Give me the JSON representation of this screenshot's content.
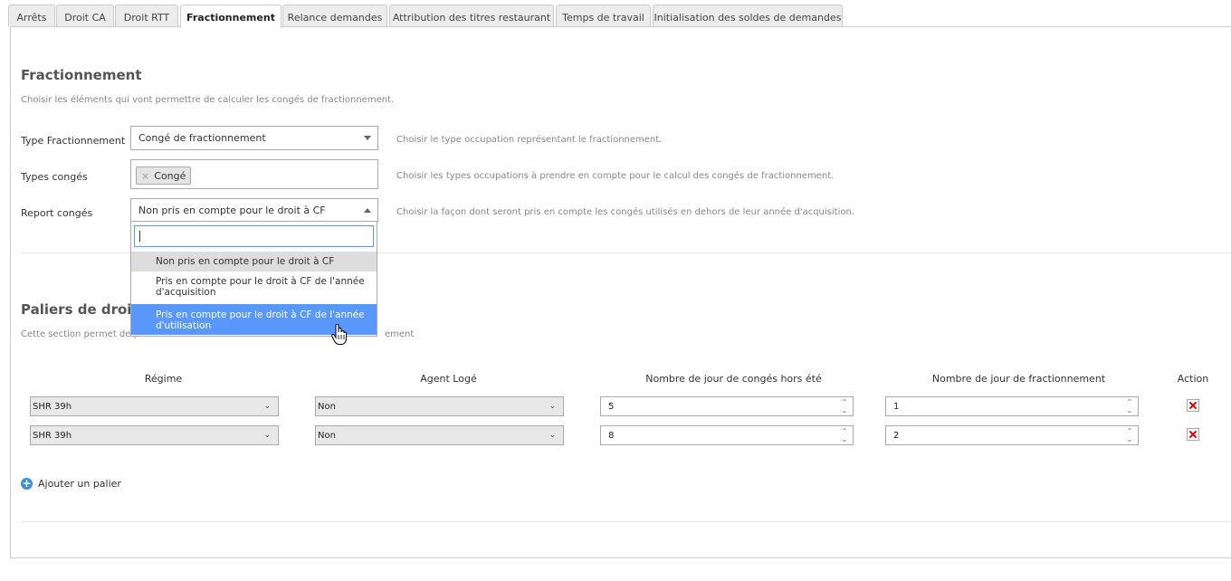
{
  "tabs": [
    "Arrêts",
    "Droit CA",
    "Droit RTT",
    "Fractionnement",
    "Relance demandes",
    "Attribution des titres restaurant",
    "Temps de travail",
    "Initialisation des soldes de demandes"
  ],
  "active_tab": "Fractionnement",
  "fractionnement": {
    "title": "Fractionnement",
    "description": "Choisir les éléments qui vont permettre de calculer les congés de fractionnement.",
    "type_label": "Type Fractionnement",
    "type_value": "Congé de fractionnement",
    "type_help": "Choisir le type occupation représentant le fractionnement.",
    "types_label": "Types congés",
    "types_chip": "Congé",
    "types_help": "Choisir les types occupations à prendre en compte pour le calcul des congés de fractionnement.",
    "report_label": "Report congés",
    "report_value": "Non pris en compte pour le droit à CF",
    "report_help": "Choisir la façon dont seront pris en compte les congés utilisés en dehors de leur année d'acquisition.",
    "search_value": "",
    "options": [
      "Non pris en compte pour le droit à CF",
      "Pris en compte pour le droit à CF de l'année d'acquisition",
      "Pris en compte pour le droit à CF de l'année d'utilisation"
    ]
  },
  "paliers": {
    "title_visible": "Paliers de droit",
    "desc_left": "Cette section permet de pa",
    "desc_right": "ement",
    "columns": [
      "Régime",
      "Agent Logé",
      "Nombre de jour de congés hors été",
      "Nombre de jour de fractionnement",
      "Action"
    ],
    "rows": [
      {
        "regime": "SHR 39h",
        "agent": "Non",
        "hors_ete": "5",
        "fractionnement": "1"
      },
      {
        "regime": "SHR 39h",
        "agent": "Non",
        "hors_ete": "8",
        "fractionnement": "2"
      }
    ],
    "add_label": "Ajouter un palier"
  },
  "icons": {
    "remove": "x-icon",
    "caret": "chevron-down-icon",
    "spin": "spinner-arrows-icon",
    "add": "plus-circle-icon",
    "delete": "delete-x-icon",
    "cursor": "hand-cursor-icon"
  },
  "colors": {
    "highlight": "#5897fb",
    "selected_option": "#dddddd",
    "delete": "#dd0000",
    "add": "#3a8fd8"
  }
}
